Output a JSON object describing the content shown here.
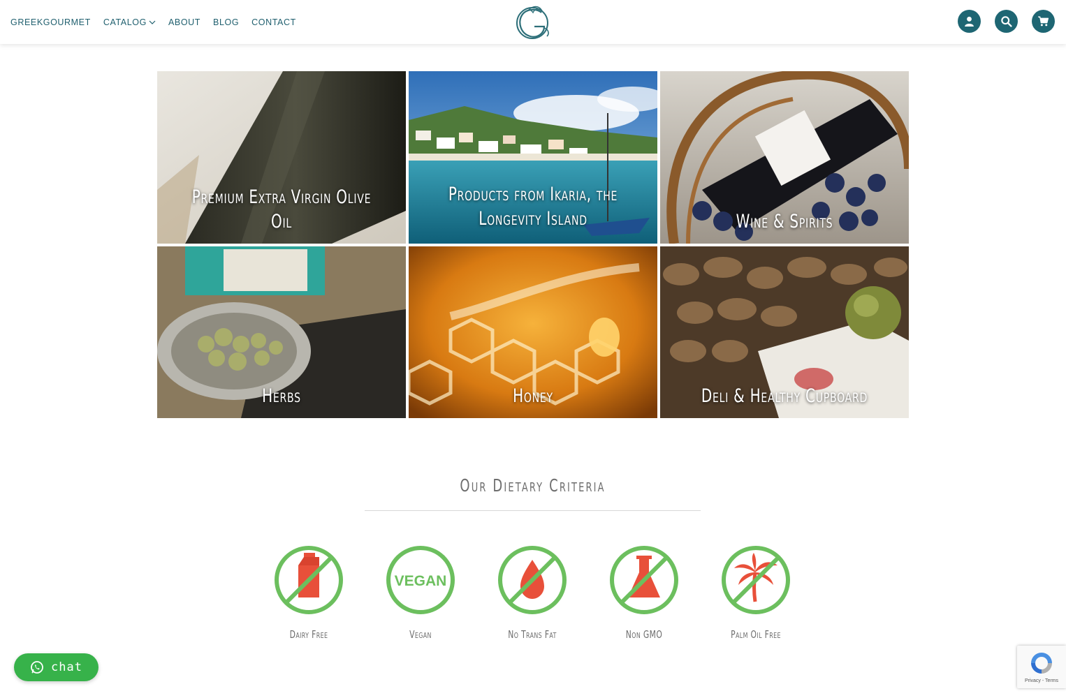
{
  "header": {
    "nav": [
      {
        "label": "GREEKGOURMET"
      },
      {
        "label": "CATALOG"
      },
      {
        "label": "ABOUT"
      },
      {
        "label": "BLOG"
      },
      {
        "label": "CONTACT"
      }
    ],
    "icons": [
      "user-icon",
      "search-icon",
      "cart-icon"
    ],
    "accent": "#1e6673"
  },
  "categories": [
    {
      "title": "Premium Extra Virgin Olive Oil"
    },
    {
      "title": "Products from Ikaria, the\nLongevity Island"
    },
    {
      "title": "Wine & Spirits"
    },
    {
      "title": "Herbs"
    },
    {
      "title": "Honey"
    },
    {
      "title": "Deli & Healthy Cupboard"
    }
  ],
  "dietary": {
    "title": "Our Dietary Criteria",
    "items": [
      {
        "label": "Dairy Free",
        "icon": "dairy-free-icon"
      },
      {
        "label": "Vegan",
        "icon": "vegan-icon",
        "badge_text": "VEGAN"
      },
      {
        "label": "No Trans Fat",
        "icon": "no-trans-fat-icon"
      },
      {
        "label": "Non GMO",
        "icon": "non-gmo-icon"
      },
      {
        "label": "Palm Oil Free",
        "icon": "palm-oil-free-icon"
      }
    ],
    "ring_color": "#6cbf5e",
    "symbol_color": "#e8503a"
  },
  "chat": {
    "label": "chat",
    "color": "#37b24a"
  },
  "recaptcha": {
    "links": "Privacy - Terms"
  }
}
